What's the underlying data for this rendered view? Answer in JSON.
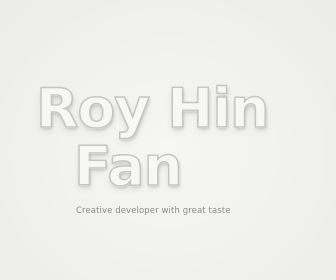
{
  "hero": {
    "line1": "Roy Hin",
    "line2": "Fan",
    "tagline": "Creative developer with great taste"
  },
  "colors": {
    "background": "#f1f1ef",
    "heading_fill": "#f7f7f6",
    "heading_outline": "#c4c4c2",
    "tagline": "#8c8c8a"
  }
}
